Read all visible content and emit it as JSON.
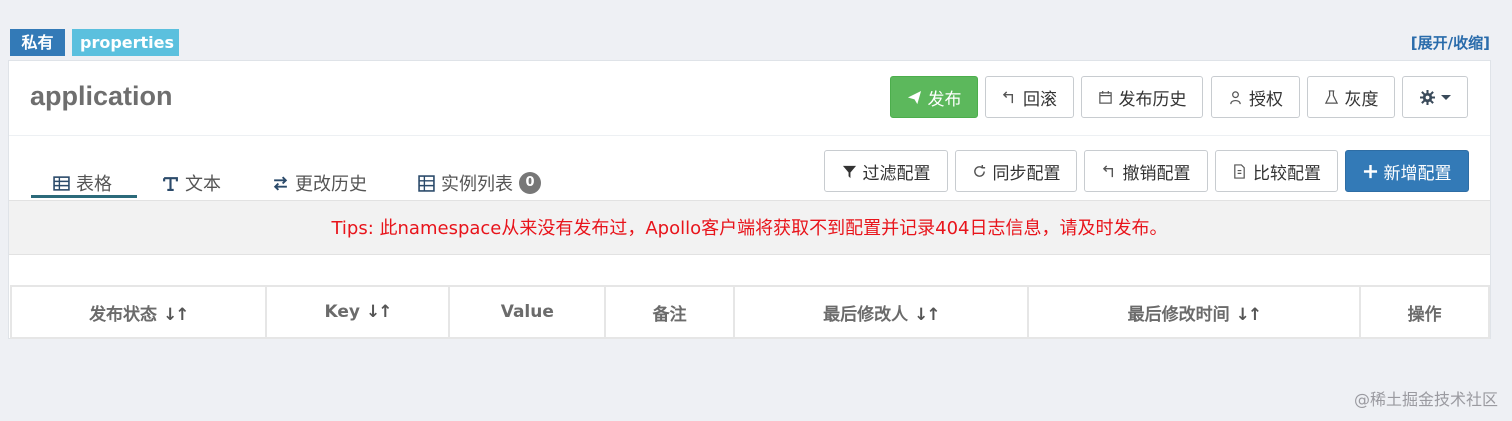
{
  "namespace": {
    "scope_badge": "私有",
    "format_badge": "properties",
    "toggle_label": "[展开/收缩]",
    "title": "application"
  },
  "actions": {
    "publish": "发布",
    "rollback": "回滚",
    "publish_history": "发布历史",
    "authorize": "授权",
    "gray": "灰度"
  },
  "tabs": [
    {
      "label": "表格",
      "icon": "table-icon"
    },
    {
      "label": "文本",
      "icon": "text-icon"
    },
    {
      "label": "更改历史",
      "icon": "exchange-icon"
    },
    {
      "label": "实例列表",
      "icon": "instance-list-icon",
      "count": "0"
    }
  ],
  "toolbar": {
    "filter": "过滤配置",
    "sync": "同步配置",
    "revoke": "撤销配置",
    "compare": "比较配置",
    "add": "新增配置"
  },
  "tips": "Tips: 此namespace从来没有发布过，Apollo客户端将获取不到配置并记录404日志信息，请及时发布。",
  "table": {
    "headers": [
      "发布状态",
      "Key",
      "Value",
      "备注",
      "最后修改人",
      "最后修改时间",
      "操作"
    ],
    "sortable": [
      "true",
      "true",
      "false",
      "false",
      "true",
      "true",
      "false"
    ]
  },
  "watermark": "@稀土掘金技术社区",
  "colors": {
    "publish": "#5cb85c",
    "primary": "#337ab7",
    "info": "#5bc0de",
    "tips_text": "#e8141b"
  }
}
